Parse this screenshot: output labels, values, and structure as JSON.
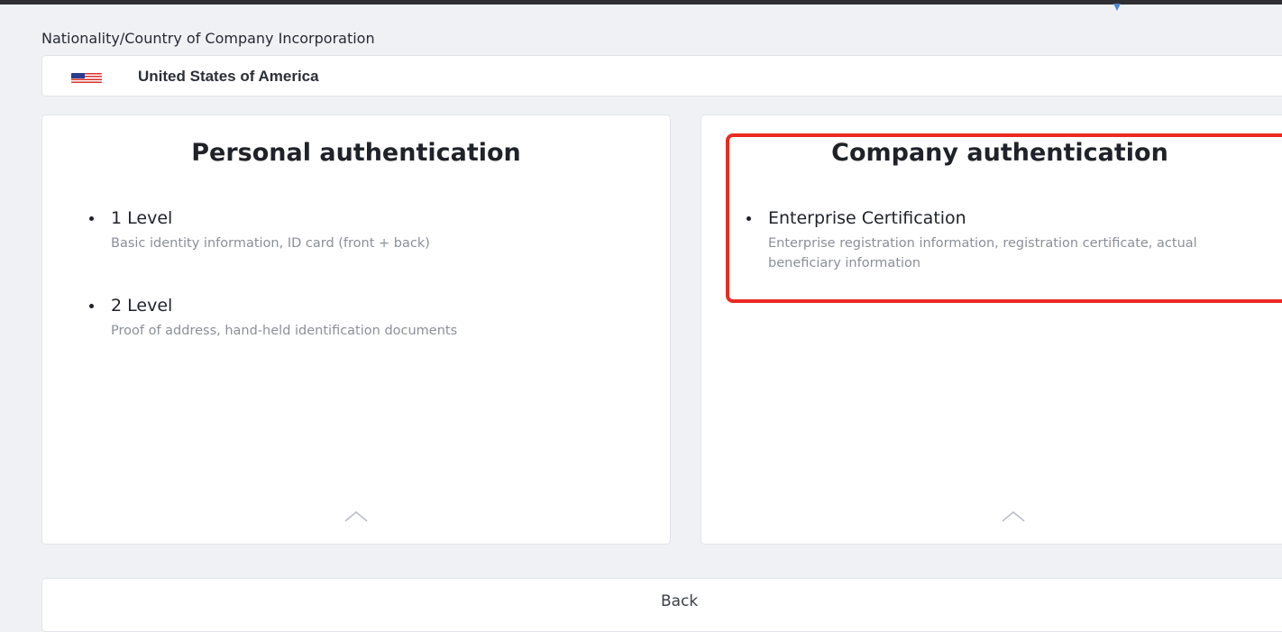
{
  "colors": {
    "page_background": "#eff1f5",
    "highlight_border": "#ea2a22",
    "top_caret": "#4a86d8"
  },
  "nationality": {
    "label": "Nationality/Country of Company Incorporation",
    "selected_value": "United States of America",
    "flag_icon": "us-flag-icon"
  },
  "personal": {
    "title": "Personal authentication",
    "levels": [
      {
        "title": "1 Level",
        "description": "Basic identity information, ID card (front + back)"
      },
      {
        "title": "2 Level",
        "description": "Proof of address, hand-held identification documents"
      }
    ],
    "collapse_icon": "chevron-up-icon"
  },
  "company": {
    "title": "Company authentication",
    "levels": [
      {
        "title": "Enterprise Certification",
        "description": "Enterprise registration information, registration certificate, actual beneficiary information"
      }
    ],
    "collapse_icon": "chevron-up-icon"
  },
  "footer": {
    "back_label": "Back"
  }
}
